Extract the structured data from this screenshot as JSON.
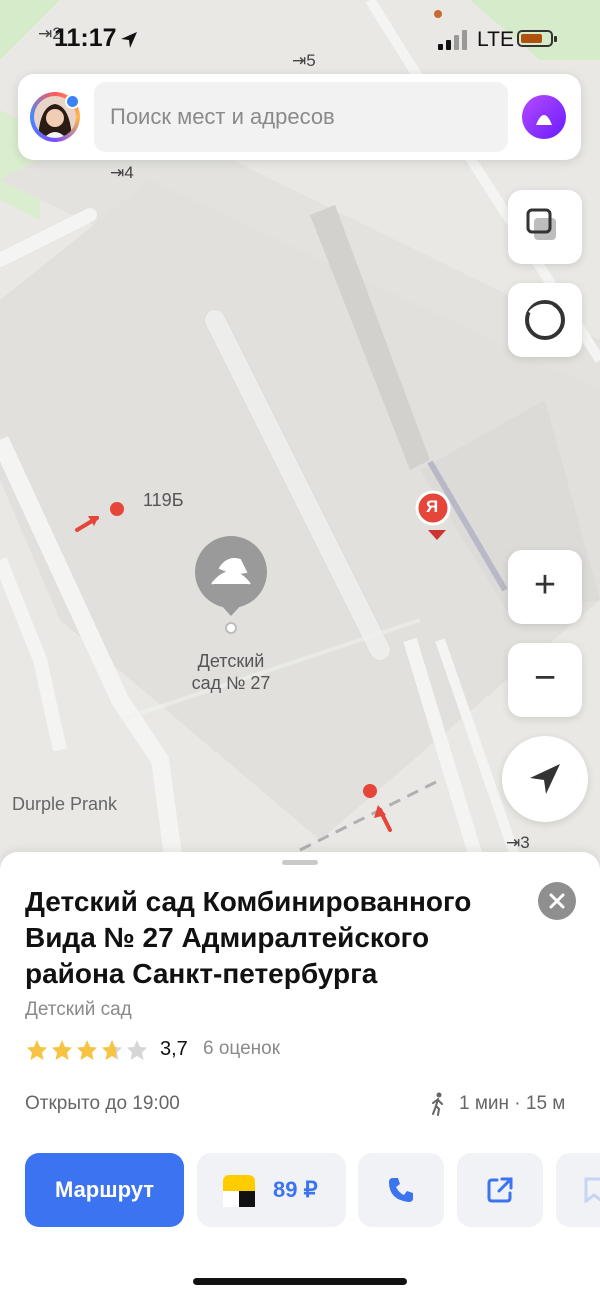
{
  "status_bar": {
    "time": "11:17",
    "network": "LTE",
    "battery_level": 0.75
  },
  "search": {
    "placeholder": "Поиск мест и адресов"
  },
  "map": {
    "entrance_labels": [
      "5",
      "4",
      "3",
      "2"
    ],
    "building_label": "119Б",
    "poi_label": "Детский\nсад № 27",
    "poi_label_line1": "Детский",
    "poi_label_line2": "сад № 27",
    "nearby_label": "Durple Prank",
    "yandex_pin_letter": "Я"
  },
  "controls": {
    "layers": "layers-icon",
    "panorama": "panorama-icon",
    "zoom_in": "+",
    "zoom_out": "−",
    "locate": "navigation-arrow-icon"
  },
  "place": {
    "title": "Детский сад Комбинированного Вида № 27 Адмиралтейского района Санкт-петербурга",
    "category": "Детский сад",
    "rating": "3,7",
    "rating_numeric": 3.7,
    "rating_count": "6 оценок",
    "hours": "Открыто до 19:00",
    "walk_info": "1 мин · 15 м"
  },
  "actions": {
    "route_label": "Маршрут",
    "taxi_price": "89 ₽"
  },
  "colors": {
    "accent": "#3c73f0",
    "pin_red": "#e6453a",
    "alice_purple": "#8a2bff"
  }
}
